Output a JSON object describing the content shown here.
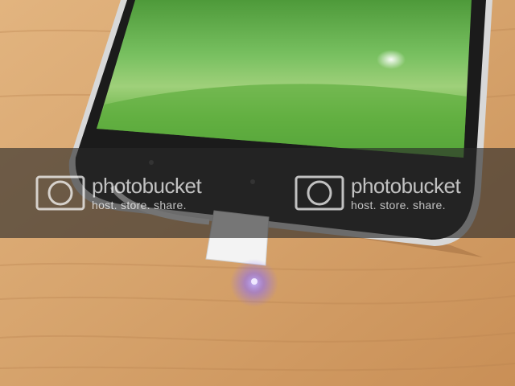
{
  "image": {
    "subject": "Tablet lying on a wooden table with a white connector plugged into its bottom edge, glowing purple light",
    "colors": {
      "wood": "#d9a872",
      "bezel": "#1a1a1a",
      "screen_green": "#7cc04a",
      "connector": "#f2f2f2",
      "led": "#8a6cff"
    }
  },
  "watermarks": [
    {
      "brand": "photobucket",
      "tagline": "host. store. share."
    },
    {
      "brand": "photobucket",
      "tagline": "host. store. share."
    }
  ]
}
